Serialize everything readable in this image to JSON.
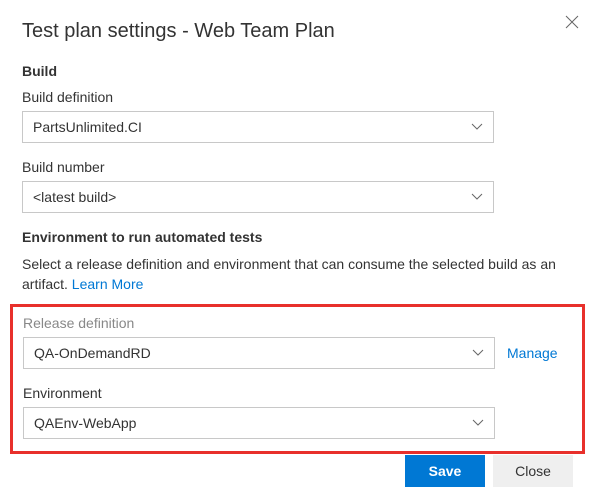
{
  "dialog": {
    "title": "Test plan settings - Web Team Plan"
  },
  "build": {
    "header": "Build",
    "definition_label": "Build definition",
    "definition_value": "PartsUnlimited.CI",
    "number_label": "Build number",
    "number_value": "<latest build>"
  },
  "environment_section": {
    "header": "Environment to run automated tests",
    "description": "Select a release definition and environment that can consume the selected build as an artifact.  ",
    "learn_more": "Learn More",
    "release_label": "Release definition",
    "release_value": "QA-OnDemandRD",
    "manage_link": "Manage",
    "env_label": "Environment",
    "env_value": "QAEnv-WebApp"
  },
  "buttons": {
    "save": "Save",
    "close": "Close"
  }
}
